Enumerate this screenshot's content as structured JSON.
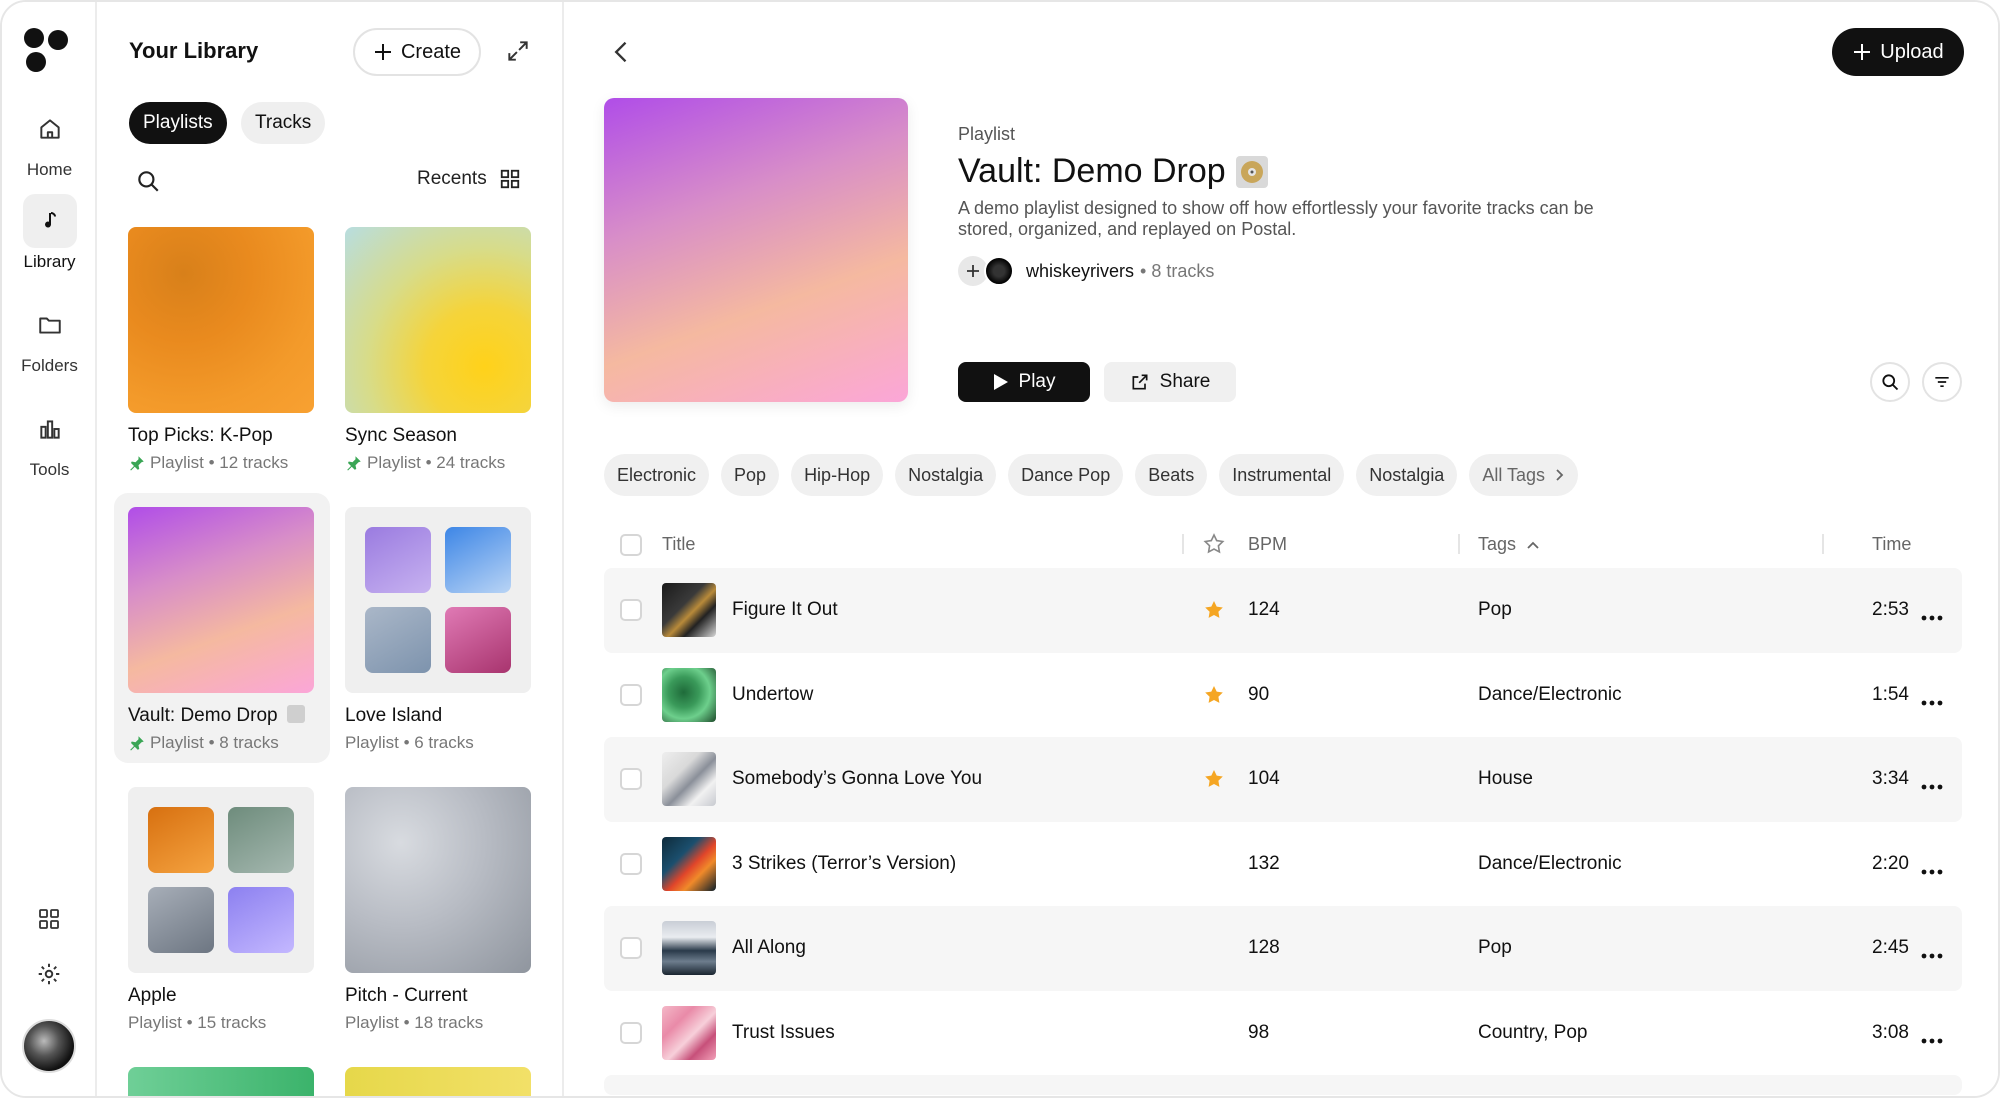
{
  "rail": {
    "items": [
      {
        "label": "Home",
        "icon": "home-icon"
      },
      {
        "label": "Library",
        "icon": "music-note-icon",
        "active": true
      },
      {
        "label": "Folders",
        "icon": "folder-icon"
      },
      {
        "label": "Tools",
        "icon": "tools-icon"
      }
    ]
  },
  "library": {
    "title": "Your Library",
    "create_label": "Create",
    "tabs": [
      "Playlists",
      "Tracks"
    ],
    "sort_label": "Recents",
    "cards": [
      {
        "name": "Top Picks: K-Pop",
        "meta": "Playlist • 12 tracks",
        "pinned": true
      },
      {
        "name": "Sync Season",
        "meta": "Playlist • 24 tracks",
        "pinned": true
      },
      {
        "name": "Vault: Demo Drop",
        "meta": "Playlist • 8 tracks",
        "pinned": true
      },
      {
        "name": "Love Island",
        "meta": "Playlist • 6 tracks",
        "pinned": false
      },
      {
        "name": "Apple",
        "meta": "Playlist • 15 tracks",
        "pinned": false
      },
      {
        "name": "Pitch - Current",
        "meta": "Playlist • 18 tracks",
        "pinned": false
      }
    ]
  },
  "header": {
    "upload_label": "Upload"
  },
  "playlist": {
    "type": "Playlist",
    "title": "Vault: Demo Drop",
    "description": "A demo playlist designed to show off how effortlessly your favorite tracks can be stored, organized, and replayed on Postal.",
    "owner": "whiskeyrivers",
    "tracks_count": "• 8 tracks",
    "play_label": "Play",
    "share_label": "Share"
  },
  "tags": [
    "Electronic",
    "Pop",
    "Hip-Hop",
    "Nostalgia",
    "Dance Pop",
    "Beats",
    "Instrumental",
    "Nostalgia",
    "All Tags"
  ],
  "table": {
    "headers": {
      "title": "Title",
      "bpm": "BPM",
      "tags": "Tags",
      "time": "Time"
    },
    "rows": [
      {
        "title": "Figure It Out",
        "starred": true,
        "bpm": "124",
        "tags": "Pop",
        "time": "2:53"
      },
      {
        "title": "Undertow",
        "starred": true,
        "bpm": "90",
        "tags": "Dance/Electronic",
        "time": "1:54"
      },
      {
        "title": "Somebody’s Gonna Love You",
        "starred": true,
        "bpm": "104",
        "tags": "House",
        "time": "3:34"
      },
      {
        "title": "3 Strikes (Terror’s Version)",
        "starred": false,
        "bpm": "132",
        "tags": "Dance/Electronic",
        "time": "2:20"
      },
      {
        "title": "All Along",
        "starred": false,
        "bpm": "128",
        "tags": "Pop",
        "time": "2:45"
      },
      {
        "title": "Trust Issues",
        "starred": false,
        "bpm": "98",
        "tags": "Country, Pop",
        "time": "3:08"
      }
    ]
  },
  "colors": {
    "accent": "#111111",
    "star": "#f5a623",
    "pin": "#3aa655"
  }
}
